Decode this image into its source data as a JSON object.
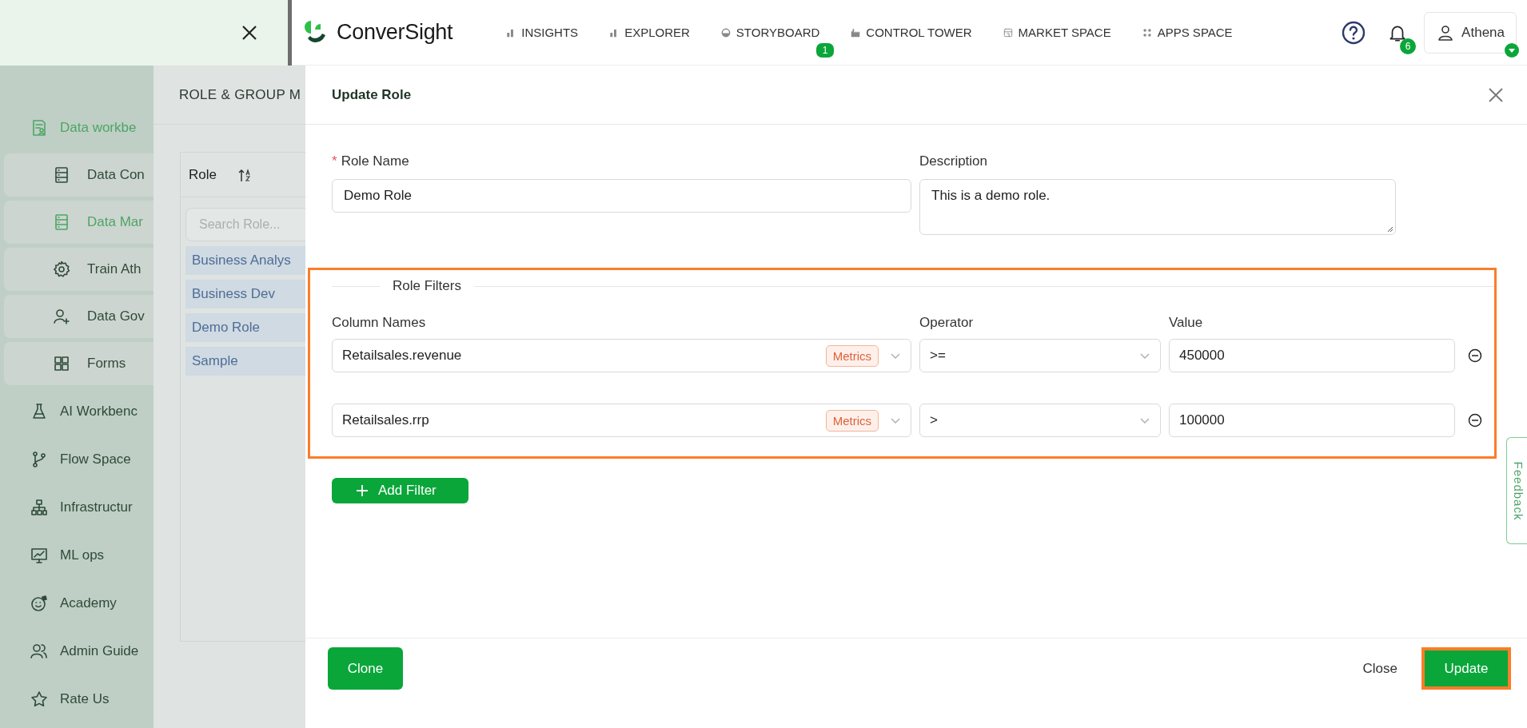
{
  "top_nav": {
    "logo": "ConverSight",
    "items": [
      {
        "label": "INSIGHTS"
      },
      {
        "label": "EXPLORER"
      },
      {
        "label": "STORYBOARD",
        "badge": "1"
      },
      {
        "label": "CONTROL TOWER"
      },
      {
        "label": "MARKET SPACE"
      },
      {
        "label": "APPS SPACE"
      }
    ],
    "notification_count": "6",
    "user": "Athena"
  },
  "sidebar": {
    "items": [
      {
        "label": "Data workbe",
        "kind": "section",
        "selected": true
      },
      {
        "label": "Data Con",
        "kind": "sub",
        "selected": false
      },
      {
        "label": "Data Mar",
        "kind": "sub",
        "selected": true
      },
      {
        "label": "Train Ath",
        "kind": "sub",
        "selected": false
      },
      {
        "label": "Data Gov",
        "kind": "sub",
        "selected": false
      },
      {
        "label": "Forms",
        "kind": "sub",
        "selected": false
      },
      {
        "label": "AI Workbenc",
        "kind": "section",
        "selected": false
      },
      {
        "label": "Flow Space",
        "kind": "section",
        "selected": false
      },
      {
        "label": "Infrastructur",
        "kind": "section",
        "selected": false
      },
      {
        "label": "ML ops",
        "kind": "section",
        "selected": false
      },
      {
        "label": "Academy",
        "kind": "section",
        "selected": false
      },
      {
        "label": "Admin Guide",
        "kind": "section",
        "selected": false
      },
      {
        "label": "Rate Us",
        "kind": "section",
        "selected": false
      }
    ]
  },
  "role_panel": {
    "title": "ROLE & GROUP M",
    "column": "Role",
    "search": {
      "placeholder": "Search Role..."
    },
    "roles": [
      "Business Analys",
      "Business Dev",
      "Demo Role",
      "Sample"
    ]
  },
  "drawer": {
    "title": "Update Role",
    "role_name": {
      "required_mark": "*",
      "label": "Role Name",
      "value": "Demo Role"
    },
    "description": {
      "label": "Description",
      "value": "This is a demo role."
    },
    "filters_title": "Role Filters",
    "columns": [
      "Column Names",
      "Operator",
      "Value"
    ],
    "filters": [
      {
        "column": "Retailsales.revenue",
        "tag": "Metrics",
        "operator": ">=",
        "value": "450000"
      },
      {
        "column": "Retailsales.rrp",
        "tag": "Metrics",
        "operator": ">",
        "value": "100000"
      }
    ],
    "add_filter": "Add Filter",
    "buttons": {
      "clone": "Clone",
      "close": "Close",
      "update": "Update"
    }
  },
  "feedback": "Feedback"
}
